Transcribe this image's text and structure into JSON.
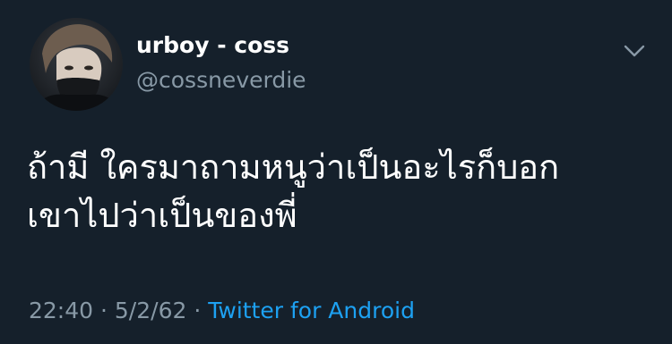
{
  "tweet": {
    "display_name": "urboy - coss",
    "handle": "@cossneverdie",
    "text_lines": [
      "ถ้ามี ใครมาถามหนูว่าเป็นอะไรก็บอก",
      "เขาไปว่าเป็นของพี่"
    ],
    "time": "22:40",
    "date": "5/2/62",
    "separator": "·",
    "source": "Twitter for Android"
  },
  "icons": {
    "menu": "chevron-down-icon",
    "avatar": "profile-photo"
  },
  "colors": {
    "background": "#15202b",
    "primary_text": "#ffffff",
    "secondary_text": "#8899a6",
    "link": "#1da1f2"
  }
}
